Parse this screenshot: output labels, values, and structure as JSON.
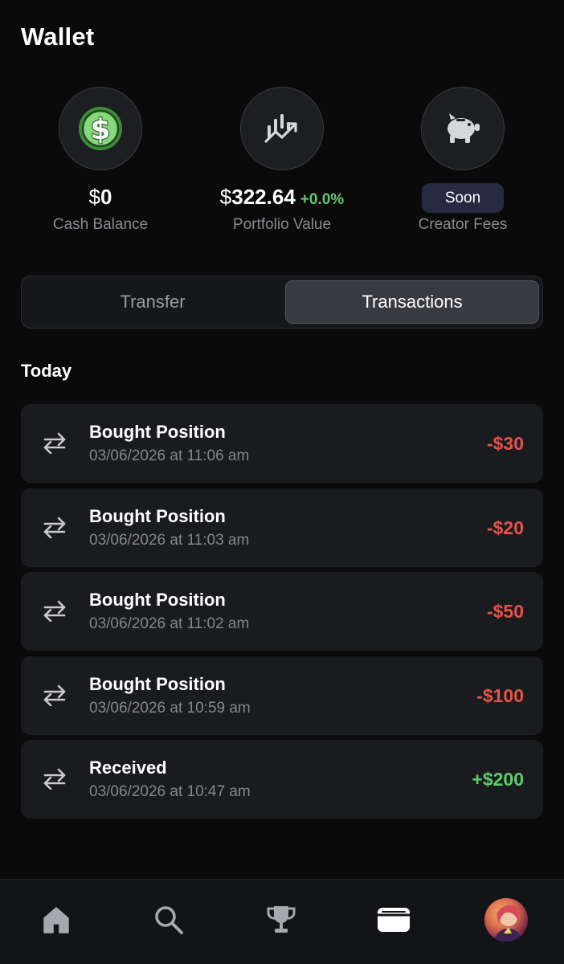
{
  "header": {
    "title": "Wallet"
  },
  "stats": {
    "cash": {
      "currency": "$",
      "amount": "0",
      "label": "Cash Balance",
      "icon": "dollar-coin-icon"
    },
    "portfolio": {
      "currency": "$",
      "amount": "322.64",
      "change": "+0.0%",
      "label": "Portfolio Value",
      "icon": "chart-trend-icon"
    },
    "creator": {
      "badge": "Soon",
      "label": "Creator Fees",
      "icon": "piggy-bank-icon"
    }
  },
  "tabs": [
    {
      "label": "Transfer",
      "selected": false
    },
    {
      "label": "Transactions",
      "selected": true
    }
  ],
  "section": {
    "title": "Today"
  },
  "transactions": [
    {
      "title": "Bought Position",
      "date": "03/06/2026 at 11:06 am",
      "amount": "-$30",
      "type": "negative",
      "icon": "transfer-arrows-icon"
    },
    {
      "title": "Bought Position",
      "date": "03/06/2026 at 11:03 am",
      "amount": "-$20",
      "type": "negative",
      "icon": "transfer-arrows-icon"
    },
    {
      "title": "Bought Position",
      "date": "03/06/2026 at 11:02 am",
      "amount": "-$50",
      "type": "negative",
      "icon": "transfer-arrows-icon"
    },
    {
      "title": "Bought Position",
      "date": "03/06/2026 at 10:59 am",
      "amount": "-$100",
      "type": "negative",
      "icon": "transfer-arrows-icon"
    },
    {
      "title": "Received",
      "date": "03/06/2026 at 10:47 am",
      "amount": "+$200",
      "type": "positive",
      "icon": "transfer-arrows-icon"
    }
  ],
  "nav": [
    {
      "name": "home",
      "icon": "home-icon",
      "active": false
    },
    {
      "name": "search",
      "icon": "search-icon",
      "active": false
    },
    {
      "name": "leaderboard",
      "icon": "trophy-icon",
      "active": false
    },
    {
      "name": "wallet",
      "icon": "wallet-icon",
      "active": true
    },
    {
      "name": "profile",
      "icon": "avatar",
      "active": false
    }
  ],
  "colors": {
    "background": "#0a0a0b",
    "card": "#1a1b1f",
    "negative": "#e5534b",
    "positive": "#5ccc6a",
    "badge": "#262a40",
    "muted_text": "#85868c"
  }
}
